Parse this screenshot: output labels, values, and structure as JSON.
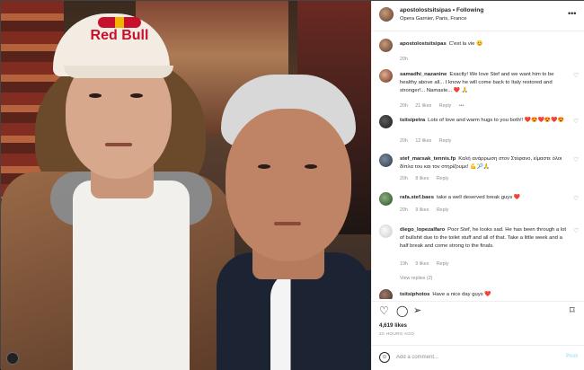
{
  "header": {
    "username": "apostolostsitsipas",
    "separator": "•",
    "follow_status": "Following",
    "location": "Opera Garnier, Paris, France",
    "more_icon": "ellipsis-icon"
  },
  "photo": {
    "cap_logo": "Red Bull",
    "tag_icon": "user-tag-icon"
  },
  "comments": [
    {
      "user": "apostolostsitsipas",
      "text": "C'est la vie 😊",
      "time": "20h",
      "likes": "",
      "reply": "",
      "liked_icon": false
    },
    {
      "user": "samadhi_nazanine",
      "text": "Exactly! We love Stef and we want him to be healthy above all... I know he will come back to Italy restored and stronger!... Namaste... ❤️ 🙏",
      "time": "20h",
      "likes": "21 likes",
      "reply": "Reply",
      "more": "•••",
      "liked_icon": true
    },
    {
      "user": "tsitsipetra",
      "text": "Lots of love and warm hugs to you both!! ❤️😍❤️😍❤️😍",
      "time": "20h",
      "likes": "12 likes",
      "reply": "Reply",
      "liked_icon": true
    },
    {
      "user": "stef_marsak_tennis.fp",
      "text": "Καλή ανάρρωση στον Στέφανο, είμαστε όλοι δίπλα του και τον στηρίζουμε! 💪🎾🙏",
      "time": "20h",
      "likes": "8 likes",
      "reply": "Reply",
      "liked_icon": true
    },
    {
      "user": "rafa.stef.baes",
      "text": "take a well deserved break guys ❤️",
      "time": "20h",
      "likes": "9 likes",
      "reply": "Reply",
      "liked_icon": true
    },
    {
      "user": "diego_lopezalfaro",
      "text": "Poor Stef, he looks sad. He has been through a lot of bullshit due to the toilet stuff and all of that. Take a little week and a half break and come strong to the finals.",
      "time": "19h",
      "likes": "9 likes",
      "reply": "Reply",
      "replies": "View replies (2)",
      "liked_icon": true
    },
    {
      "user": "tsitsiphotos",
      "text": "Have a nice day guys ❤️",
      "time": "",
      "likes": "",
      "reply": "",
      "liked_icon": false
    }
  ],
  "actions": {
    "like_icon": "heart-icon",
    "comment_icon": "comment-icon",
    "share_icon": "send-icon",
    "save_icon": "bookmark-icon"
  },
  "likes_count": "4,619 likes",
  "time_ago": "20 HOURS AGO",
  "add_comment": {
    "placeholder": "Add a comment...",
    "post_label": "Post",
    "emoji_icon": "emoji-icon"
  }
}
